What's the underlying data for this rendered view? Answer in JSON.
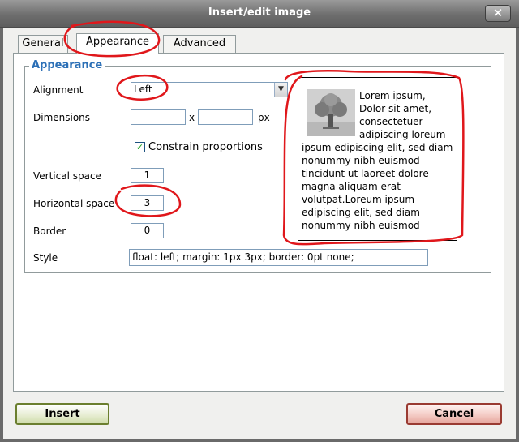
{
  "window": {
    "title": "Insert/edit image",
    "close_symbol": "✕"
  },
  "tabs": [
    {
      "label": "General",
      "active": false
    },
    {
      "label": "Appearance",
      "active": true
    },
    {
      "label": "Advanced",
      "active": false
    }
  ],
  "appearance": {
    "legend": "Appearance",
    "alignment": {
      "label": "Alignment",
      "value": "Left"
    },
    "dimensions": {
      "label": "Dimensions",
      "width": "",
      "height": "",
      "separator": "x",
      "unit": "px"
    },
    "constrain": {
      "label": "Constrain proportions",
      "checked": true
    },
    "vertical_space": {
      "label": "Vertical space",
      "value": "1"
    },
    "horizontal_space": {
      "label": "Horizontal space",
      "value": "3"
    },
    "border": {
      "label": "Border",
      "value": "0"
    },
    "style": {
      "label": "Style",
      "value": "float: left; margin: 1px 3px; border: 0pt none;"
    }
  },
  "preview": {
    "image_icon": "tree-image-icon",
    "text": "Lorem ipsum, Dolor sit amet, consectetuer adipiscing loreum ipsum edipiscing elit, sed diam nonummy nibh euismod tincidunt ut laoreet dolore magna aliquam erat volutpat.Loreum ipsum edipiscing elit, sed diam nonummy nibh euismod"
  },
  "buttons": {
    "insert": "Insert",
    "cancel": "Cancel"
  },
  "colors": {
    "legend": "#2b6fb6",
    "annotation": "#e0171b",
    "checkmark": "#21a121"
  }
}
